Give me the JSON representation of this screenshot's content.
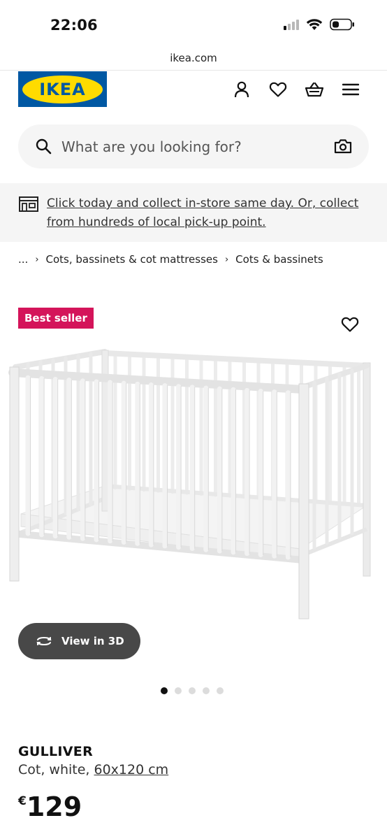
{
  "status_bar": {
    "time": "22:06"
  },
  "browser": {
    "url": "ikea.com"
  },
  "header": {
    "logo_text": "IKEA",
    "icons": [
      "person-icon",
      "heart-icon",
      "basket-icon",
      "menu-icon"
    ]
  },
  "search": {
    "placeholder": "What are you looking for?"
  },
  "banner": {
    "text": "Click today and collect in-store same day. Or, collect from hundreds of local pick-up point."
  },
  "breadcrumb": {
    "ellipsis": "...",
    "items": [
      "Cots, bassinets & cot mattresses",
      "Cots & bassinets"
    ]
  },
  "product": {
    "badge": "Best seller",
    "view_3d_label": "View in 3D",
    "image_count": 5,
    "active_image": 1,
    "name": "GULLIVER",
    "description": "Cot, white, ",
    "size": "60x120 cm",
    "currency": "€",
    "price": "129"
  },
  "colors": {
    "ikea_blue": "#0058a3",
    "ikea_yellow": "#ffdb00",
    "badge": "#d4145a",
    "view_3d_bg": "#484848"
  }
}
